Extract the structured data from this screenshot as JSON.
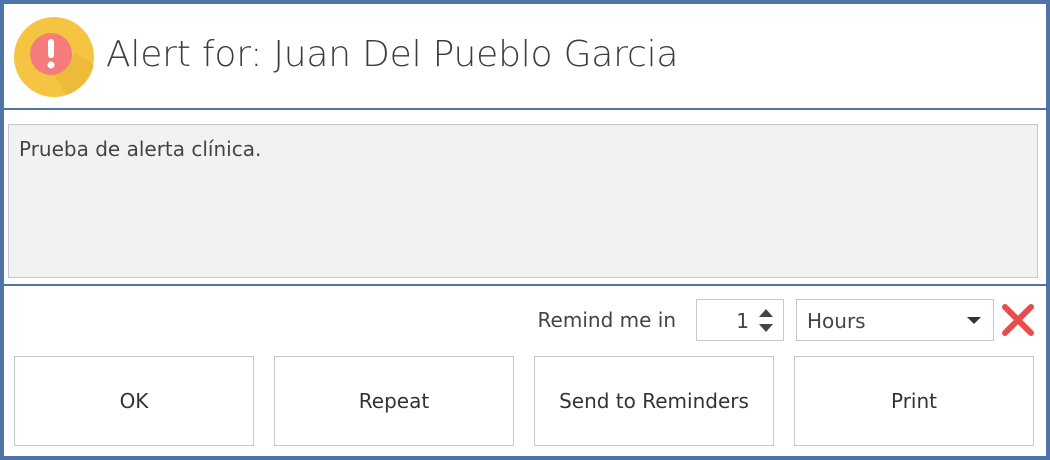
{
  "header": {
    "title": "Alert for: Juan Del Pueblo Garcia",
    "icon": "alert-exclamation-icon",
    "icon_bg_color": "#f5c542",
    "icon_fg_color": "#f47c7c"
  },
  "message": {
    "text": "Prueba de alerta clínica."
  },
  "reminder": {
    "label": "Remind me in",
    "amount": "1",
    "unit": "Hours",
    "clear_icon": "close-x-icon",
    "clear_color": "#e84c4c"
  },
  "buttons": {
    "ok": "OK",
    "repeat": "Repeat",
    "send_to_reminders": "Send to Reminders",
    "print": "Print"
  },
  "colors": {
    "border_accent": "#4f74a8",
    "message_bg": "#f2f2f2"
  }
}
